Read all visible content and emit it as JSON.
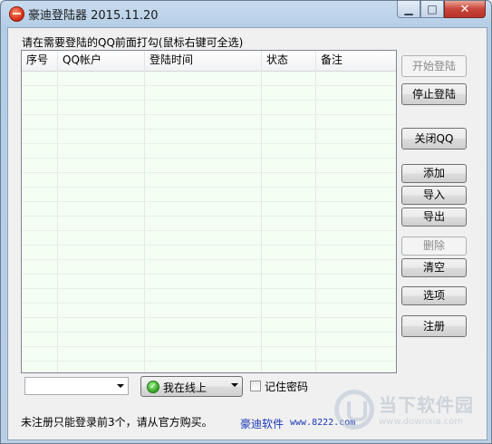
{
  "window": {
    "title": "豪迪登陆器 2015.11.20",
    "minimize_glyph": "▁",
    "maximize_glyph": "□",
    "close_glyph": "✕"
  },
  "group_label": "请在需要登陆的QQ前面打勾(鼠标右键可全选)",
  "table": {
    "columns": [
      "序号",
      "QQ帐户",
      "登陆时间",
      "状态",
      "备注"
    ],
    "rows": []
  },
  "buttons": {
    "start_login": "开始登陆",
    "stop_login": "停止登陆",
    "close_qq": "关闭QQ",
    "add": "添加",
    "import": "导入",
    "export": "导出",
    "delete": "删除",
    "clear": "清空",
    "options": "选项",
    "register": "注册"
  },
  "account_combo": {
    "value": ""
  },
  "status_select": {
    "value": "我在线上",
    "icon": "online-check-icon"
  },
  "remember_password": {
    "label": "记住密码",
    "checked": false
  },
  "footer": {
    "notice": "未注册只能登录前3个，请从官方购买。",
    "vendor": "豪迪软件",
    "site": "www.8222.com"
  },
  "watermark": {
    "title": "当下软件园",
    "site": "www.downxia.com"
  },
  "colors": {
    "list_background": "#f4fff4",
    "link": "#1a39b8",
    "close_button": "#c8453a"
  }
}
